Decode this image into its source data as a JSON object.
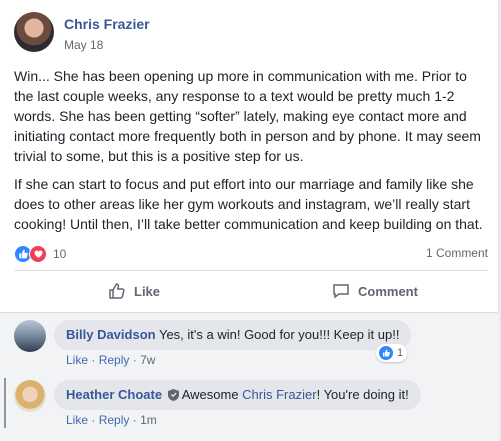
{
  "post": {
    "author": "Chris Frazier",
    "date": "May 18",
    "paragraph1": "Win... She has been opening up more in communication with me. Prior to the last couple weeks, any response to a text would be pretty much 1-2 words. She has been getting “softer” lately, making eye contact more and initiating contact more frequently both in person and by phone. It may seem trivial to some, but this is a positive step for us.",
    "paragraph2": "If she can start to focus and put effort into our marriage and family like she does to other areas like her gym workouts and instagram, we’ll really start cooking! Until then, I’ll take better communication and keep building on that.",
    "reaction_count": "10",
    "comment_count": "1 Comment",
    "like_label": "Like",
    "comment_label": "Comment"
  },
  "comments": [
    {
      "name": "Billy Davidson",
      "text": "Yes, it's a win! Good for you!!! Keep it up!!",
      "like": "Like",
      "reply": "Reply",
      "sep": "·",
      "time": "7w",
      "reaction_count": "1"
    },
    {
      "name": "Heather Choate",
      "text_pre": "Awesome ",
      "mention": "Chris Frazier",
      "text_post": "! You're doing it!",
      "like": "Like",
      "reply": "Reply",
      "sep": "·",
      "time": "1m"
    }
  ],
  "colors": {
    "link": "#385898",
    "like_blue": "#2d88ff",
    "love_red": "#f33e58"
  }
}
